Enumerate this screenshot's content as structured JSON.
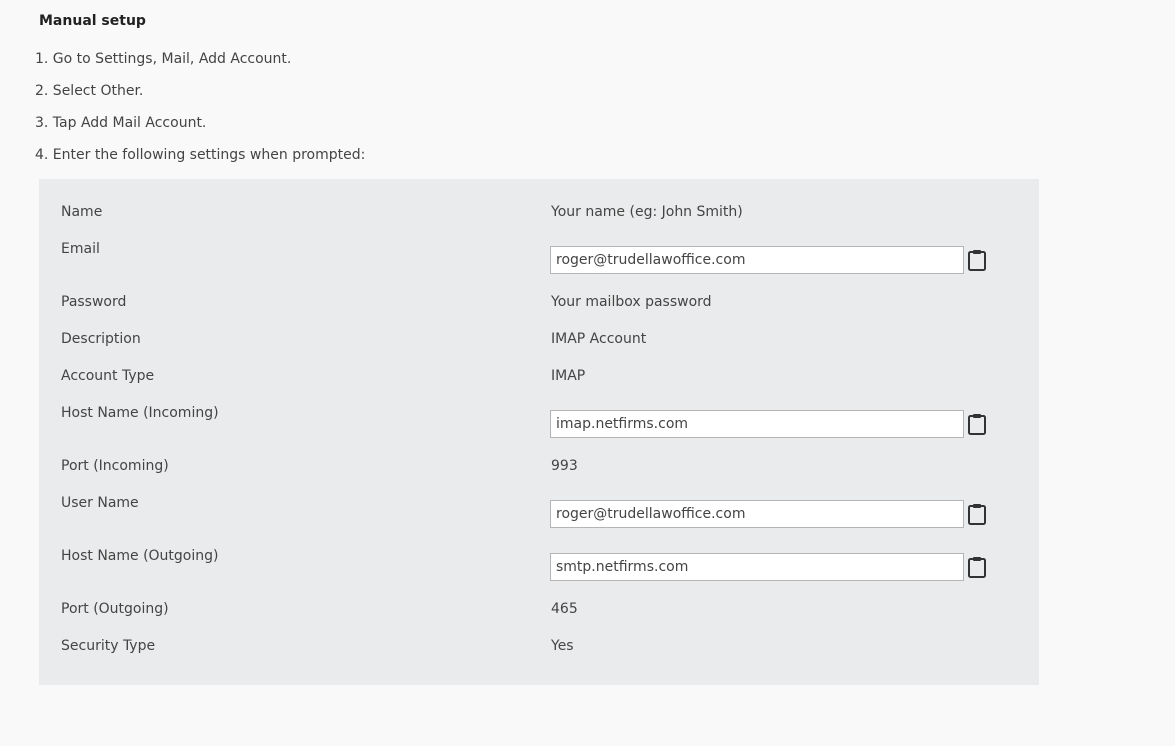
{
  "title": "Manual setup",
  "steps": [
    "1. Go to Settings, Mail, Add Account.",
    "2. Select Other.",
    "3. Tap Add Mail Account.",
    "4. Enter the following settings when prompted:"
  ],
  "settings": {
    "name": {
      "label": "Name",
      "value": "Your name (eg: John Smith)"
    },
    "email": {
      "label": "Email",
      "value": "roger@trudellawoffice.com"
    },
    "password": {
      "label": "Password",
      "value": "Your mailbox password"
    },
    "description": {
      "label": "Description",
      "value": "IMAP Account"
    },
    "account_type": {
      "label": "Account Type",
      "value": "IMAP"
    },
    "host_incoming": {
      "label": "Host Name (Incoming)",
      "value": "imap.netfirms.com"
    },
    "port_incoming": {
      "label": "Port (Incoming)",
      "value": "993"
    },
    "user_name": {
      "label": "User Name",
      "value": "roger@trudellawoffice.com"
    },
    "host_outgoing": {
      "label": "Host Name (Outgoing)",
      "value": "smtp.netfirms.com"
    },
    "port_outgoing": {
      "label": "Port (Outgoing)",
      "value": "465"
    },
    "security_type": {
      "label": "Security Type",
      "value": "Yes"
    }
  },
  "icons": {
    "copy": "clipboard-icon"
  }
}
